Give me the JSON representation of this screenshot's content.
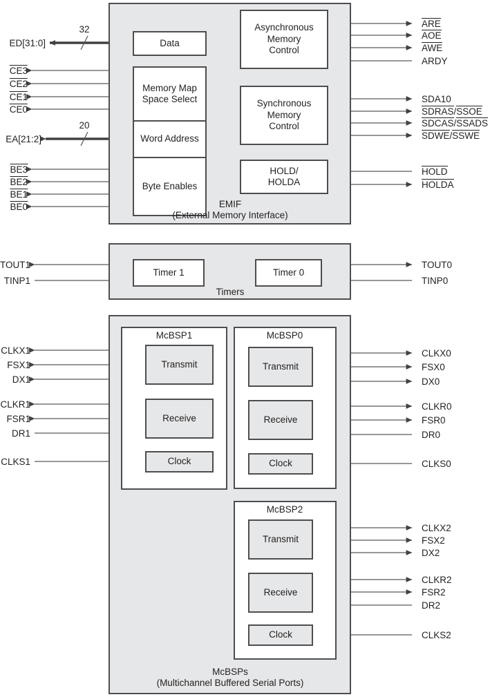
{
  "diagram": {
    "title": "DSP Peripherals Block Diagram",
    "colors": {
      "panel_fill": "#e6e7e8",
      "box_fill_white": "#ffffff",
      "box_fill_shaded": "#e6e7e8",
      "border": "#4d4d4f",
      "wire": "#58595b",
      "text": "#231f20"
    }
  },
  "emif": {
    "panel_label_line1": "EMIF",
    "panel_label_line2": "(External Memory Interface)",
    "blocks": {
      "data": "Data",
      "memory_map": "Memory Map\nSpace Select",
      "memory_map_line1": "Memory Map",
      "memory_map_line2": "Space Select",
      "word_address": "Word Address",
      "byte_enables": "Byte Enables",
      "async_line1": "Asynchronous",
      "async_line2": "Memory",
      "async_line3": "Control",
      "sync_line1": "Synchronous",
      "sync_line2": "Memory",
      "sync_line3": "Control",
      "hold_line1": "HOLD/",
      "hold_line2": "HOLDA"
    },
    "bus_widths": {
      "data_bus": "32",
      "address_bus": "20"
    },
    "left_signals": [
      {
        "name": "ED[31:0]",
        "overbar": false,
        "direction": "bidirectional",
        "bus": true,
        "width": "32"
      },
      {
        "name": "CE3",
        "overbar": true,
        "direction": "output",
        "bus": false
      },
      {
        "name": "CE2",
        "overbar": true,
        "direction": "output",
        "bus": false
      },
      {
        "name": "CE1",
        "overbar": true,
        "direction": "output",
        "bus": false
      },
      {
        "name": "CE0",
        "overbar": true,
        "direction": "output",
        "bus": false
      },
      {
        "name": "EA[21:2]",
        "overbar": false,
        "direction": "output",
        "bus": true,
        "width": "20"
      },
      {
        "name": "BE3",
        "overbar": true,
        "direction": "output",
        "bus": false
      },
      {
        "name": "BE2",
        "overbar": true,
        "direction": "output",
        "bus": false
      },
      {
        "name": "BE1",
        "overbar": true,
        "direction": "output",
        "bus": false
      },
      {
        "name": "BE0",
        "overbar": true,
        "direction": "output",
        "bus": false
      }
    ],
    "right_signals": [
      {
        "name": "ARE",
        "overbar": true,
        "direction": "output"
      },
      {
        "name": "AOE",
        "overbar": true,
        "direction": "output"
      },
      {
        "name": "AWE",
        "overbar": true,
        "direction": "output"
      },
      {
        "name": "ARDY",
        "overbar": false,
        "direction": "input"
      },
      {
        "name": "SDA10",
        "overbar": false,
        "direction": "output"
      },
      {
        "name": "SDRAS/SSOE",
        "part1": "SDRAS",
        "part2": "SSOE",
        "overbar_both": true,
        "direction": "output"
      },
      {
        "name": "SDCAS/SSADS",
        "part1": "SDCAS",
        "part2": "SSADS",
        "overbar_both": true,
        "direction": "output"
      },
      {
        "name": "SDWE/SSWE",
        "part1": "SDWE",
        "part2": "SSWE",
        "overbar_both": true,
        "direction": "output"
      },
      {
        "name": "HOLD",
        "overbar": true,
        "direction": "input"
      },
      {
        "name": "HOLDA",
        "overbar": true,
        "direction": "output"
      }
    ]
  },
  "timers": {
    "panel_label": "Timers",
    "blocks": {
      "timer1": "Timer 1",
      "timer0": "Timer 0"
    },
    "left_signals": [
      {
        "name": "TOUT1",
        "direction": "output"
      },
      {
        "name": "TINP1",
        "direction": "input"
      }
    ],
    "right_signals": [
      {
        "name": "TOUT0",
        "direction": "output"
      },
      {
        "name": "TINP0",
        "direction": "input"
      }
    ]
  },
  "mcbsps": {
    "panel_label_line1": "McBSPs",
    "panel_label_line2": "(Multichannel Buffered Serial Ports)",
    "ports": [
      {
        "title": "McBSP1",
        "side": "left",
        "blocks": {
          "transmit": "Transmit",
          "receive": "Receive",
          "clock": "Clock"
        },
        "signals": [
          {
            "name": "CLKX1",
            "direction": "bidirectional"
          },
          {
            "name": "FSX1",
            "direction": "bidirectional"
          },
          {
            "name": "DX1",
            "direction": "output"
          },
          {
            "name": "CLKR1",
            "direction": "bidirectional"
          },
          {
            "name": "FSR1",
            "direction": "bidirectional"
          },
          {
            "name": "DR1",
            "direction": "input"
          },
          {
            "name": "CLKS1",
            "direction": "input"
          }
        ]
      },
      {
        "title": "McBSP0",
        "side": "right",
        "blocks": {
          "transmit": "Transmit",
          "receive": "Receive",
          "clock": "Clock"
        },
        "signals": [
          {
            "name": "CLKX0",
            "direction": "bidirectional"
          },
          {
            "name": "FSX0",
            "direction": "bidirectional"
          },
          {
            "name": "DX0",
            "direction": "output"
          },
          {
            "name": "CLKR0",
            "direction": "bidirectional"
          },
          {
            "name": "FSR0",
            "direction": "bidirectional"
          },
          {
            "name": "DR0",
            "direction": "input"
          },
          {
            "name": "CLKS0",
            "direction": "input"
          }
        ]
      },
      {
        "title": "McBSP2",
        "side": "right",
        "blocks": {
          "transmit": "Transmit",
          "receive": "Receive",
          "clock": "Clock"
        },
        "signals": [
          {
            "name": "CLKX2",
            "direction": "bidirectional"
          },
          {
            "name": "FSX2",
            "direction": "bidirectional"
          },
          {
            "name": "DX2",
            "direction": "output"
          },
          {
            "name": "CLKR2",
            "direction": "bidirectional"
          },
          {
            "name": "FSR2",
            "direction": "bidirectional"
          },
          {
            "name": "DR2",
            "direction": "input"
          },
          {
            "name": "CLKS2",
            "direction": "input"
          }
        ]
      }
    ]
  }
}
